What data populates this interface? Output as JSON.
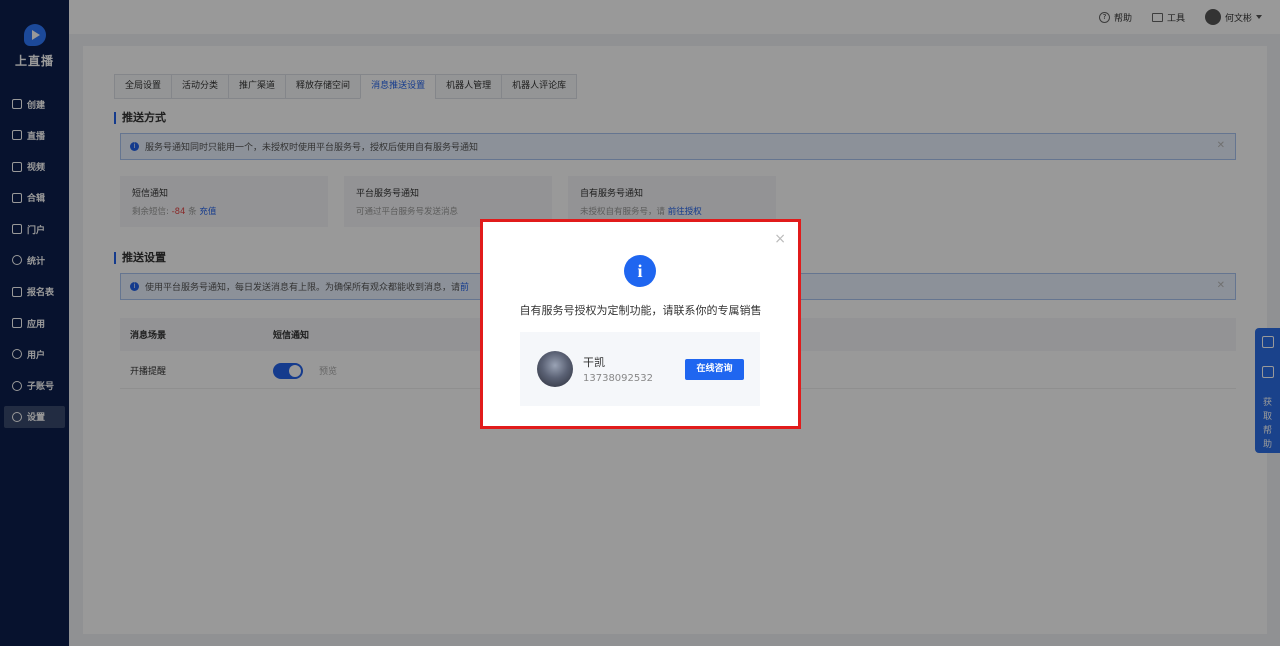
{
  "brand": {
    "name": "上直播"
  },
  "sidebar": {
    "items": [
      {
        "label": "创建"
      },
      {
        "label": "直播"
      },
      {
        "label": "视频"
      },
      {
        "label": "合辑"
      },
      {
        "label": "门户"
      },
      {
        "label": "统计"
      },
      {
        "label": "报名表"
      },
      {
        "label": "应用"
      },
      {
        "label": "用户"
      },
      {
        "label": "子账号"
      },
      {
        "label": "设置"
      }
    ]
  },
  "topbar": {
    "help": "帮助",
    "tools": "工具",
    "user": "何文彬"
  },
  "tabs": [
    "全局设置",
    "活动分类",
    "推广渠道",
    "释放存储空间",
    "消息推送设置",
    "机器人管理",
    "机器人评论库"
  ],
  "push_method": {
    "title": "推送方式",
    "alert": "服务号通知同时只能用一个，未授权时使用平台服务号，授权后使用自有服务号通知",
    "cards": {
      "sms": {
        "title": "短信通知",
        "remaining_label": "剩余短信:",
        "remaining_value": "-84",
        "unit": "条",
        "action": "充值"
      },
      "platform": {
        "title": "平台服务号通知",
        "desc": "可通过平台服务号发送消息"
      },
      "own": {
        "title": "自有服务号通知",
        "desc": "未授权自有服务号，请",
        "action": "前往授权"
      }
    }
  },
  "push_settings": {
    "title": "推送设置",
    "alert": "使用平台服务号通知，每日发送消息有上限。为确保所有观众都能收到消息，请",
    "alert_link": "前"
  },
  "table": {
    "headers": [
      "消息场景",
      "短信通知"
    ],
    "rows": [
      {
        "scene": "开播提醒",
        "preview": "预览"
      }
    ]
  },
  "helpbar": {
    "text": "获取帮助"
  },
  "modal": {
    "close": "×",
    "icon": "i",
    "message": "自有服务号授权为定制功能，请联系你的专属销售",
    "contact": {
      "name": "干凯",
      "phone": "13738092532",
      "button": "在线咨询"
    }
  }
}
